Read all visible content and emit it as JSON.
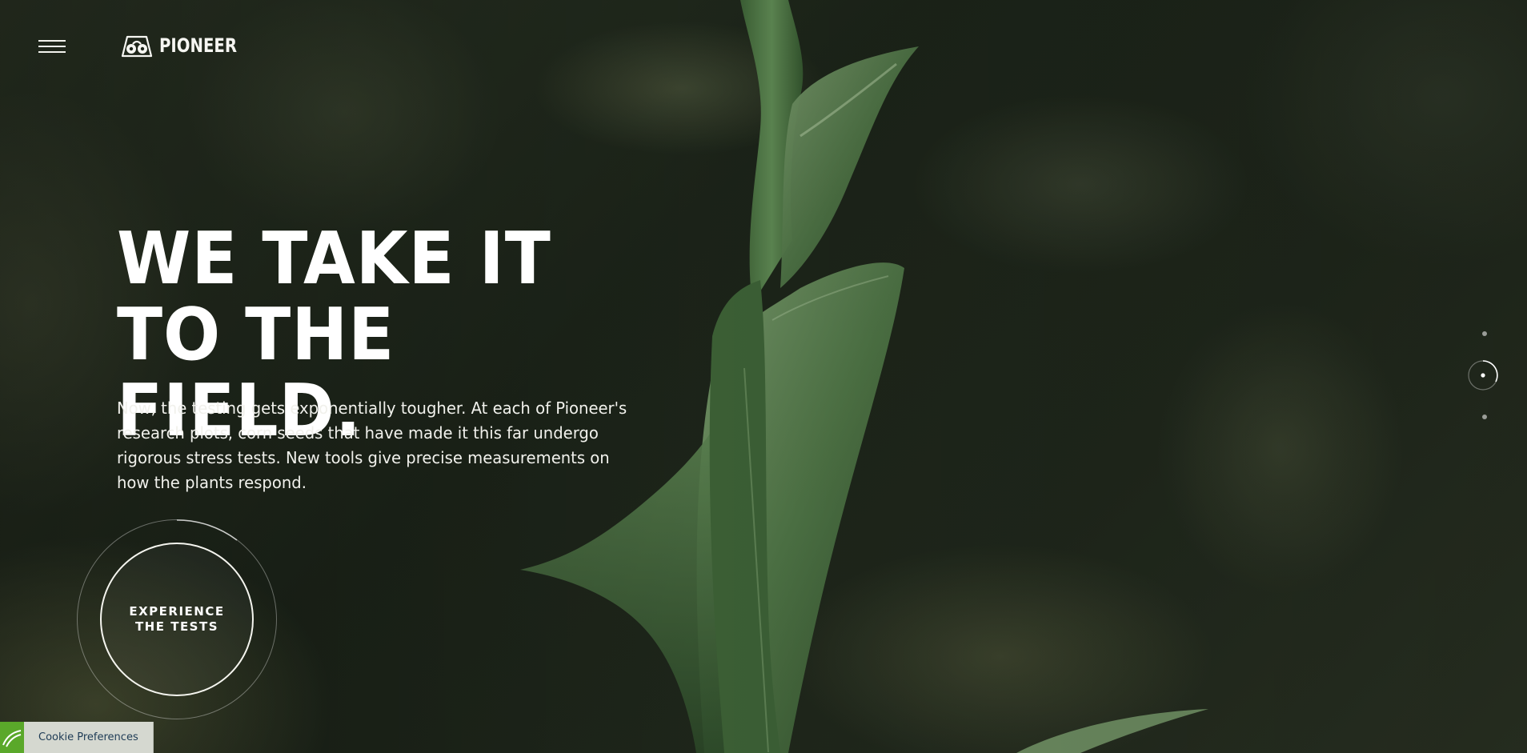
{
  "header": {
    "menu_icon": "hamburger-menu-icon",
    "logo_text": "PIONEER",
    "logo_icon": "pioneer-logo-icon"
  },
  "hero": {
    "headline": "WE TAKE IT TO THE FIELD.",
    "intro": "Now, the testing gets exponentially tougher. At each of Pioneer's research plots, corn seeds that have made it this far undergo rigorous stress tests. New tools give precise measurements on how the plants respond.",
    "cta_label": "EXPERIENCE THE TESTS"
  },
  "pager": {
    "total": 3,
    "active_index": 2
  },
  "cookie": {
    "label": "Cookie Preferences",
    "icon": "cookie-leaf-icon"
  },
  "colors": {
    "text": "#ffffff",
    "cookie_accent": "#5aa82a",
    "cookie_text": "#1e3b55",
    "background": "#1c2419"
  }
}
